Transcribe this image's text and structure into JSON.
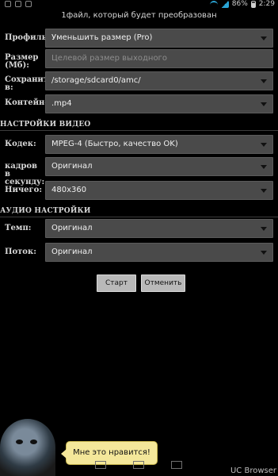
{
  "statusbar": {
    "battery_percent": "86%",
    "time": "2:29",
    "icons": [
      "notification-icon",
      "notification-icon",
      "notification-icon",
      "wifi-icon",
      "signal-icon",
      "battery-icon"
    ]
  },
  "subtitle": "1файл, который будет преобразован",
  "form": {
    "profile": {
      "label": "Профиль:",
      "value": "Уменьшить размер (Pro)"
    },
    "size": {
      "label": "Размер (Мб):",
      "placeholder": "Целевой размер выходного"
    },
    "save": {
      "label": "Сохранить в:",
      "value": "/storage/sdcard0/amc/"
    },
    "container": {
      "label": "Контейнер:",
      "value": ".mp4"
    }
  },
  "video_section": {
    "title": "НАСТРОЙКИ ВИДЕО",
    "codec": {
      "label": "Кодек:",
      "value": "MPEG-4 (Быстро, качество OK)"
    },
    "fps": {
      "label": "кадров в секунду:",
      "value": "Оригинал"
    },
    "resolution": {
      "label": "Ничего:",
      "value": "480x360"
    }
  },
  "audio_section": {
    "title": "АУДИО НАСТРОЙКИ",
    "tempo": {
      "label": "Темп:",
      "value": "Оригинал"
    },
    "stream": {
      "label": "Поток:",
      "value": "Оригинал"
    }
  },
  "buttons": {
    "start": "Старт",
    "cancel": "Отменить"
  },
  "overlay": {
    "bubble_text": "Мне это нравится!",
    "browser_label": "UC Browser"
  },
  "colors": {
    "accent": "#2aa5d6",
    "field_bg": "#4a4a4a",
    "bubble": "#f4e79a"
  }
}
